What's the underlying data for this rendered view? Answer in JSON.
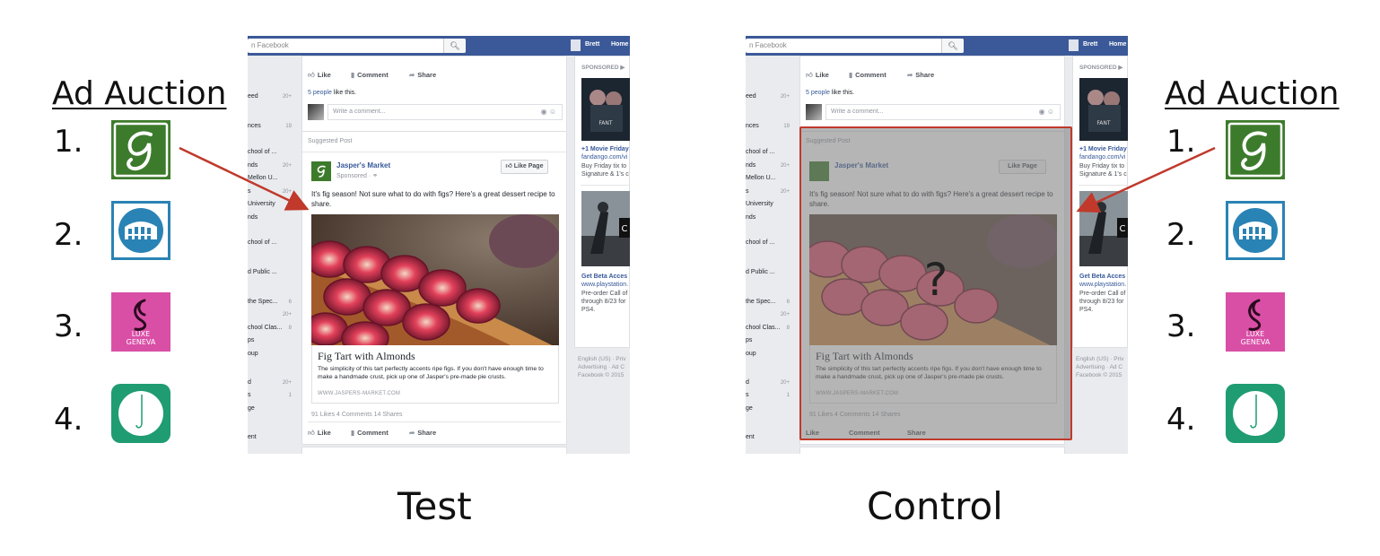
{
  "auction_left": {
    "title": "Ad Auction",
    "ranks": [
      "1.",
      "2.",
      "3.",
      "4."
    ],
    "logos": [
      "jaspers-market-logo-icon",
      "colosseum-logo-icon",
      "luxe-geneva-logo-icon",
      "hook-logo-icon"
    ],
    "luxe_geneva_text": [
      "LUXE",
      "GENEVA"
    ]
  },
  "auction_right": {
    "title": "Ad Auction",
    "ranks": [
      "1.",
      "2.",
      "3.",
      "4."
    ],
    "luxe_geneva_text": [
      "LUXE",
      "GENEVA"
    ]
  },
  "colors": {
    "facebook_blue": "#3b5998",
    "link_blue": "#365899",
    "arrow_red": "#c0392b",
    "jaspers_green": "#3d7b2c",
    "colosseum_blue": "#2a83b5",
    "luxe_pink": "#d94fa6",
    "hook_teal": "#1f9c72"
  },
  "facebook_test": {
    "search_placeholder": "n Facebook",
    "user_name": "Brett",
    "home": "Home",
    "leftnav": [
      {
        "label": "eed",
        "count": "20+"
      },
      {
        "label": "nces",
        "count": "19"
      },
      {
        "label": "chool of ...",
        "count": ""
      },
      {
        "label": "nds",
        "count": "20+"
      },
      {
        "label": "Mellon U...",
        "count": ""
      },
      {
        "label": "s",
        "count": "20+"
      },
      {
        "label": "University",
        "count": ""
      },
      {
        "label": "nds",
        "count": ""
      },
      {
        "label": "chool of ...",
        "count": ""
      },
      {
        "label": "d Public ...",
        "count": ""
      },
      {
        "label": "the Spec...",
        "count": "6"
      },
      {
        "label": "",
        "count": "20+"
      },
      {
        "label": "chool Clas...",
        "count": "8"
      },
      {
        "label": "ps",
        "count": ""
      },
      {
        "label": "oup",
        "count": ""
      },
      {
        "label": "d",
        "count": "20+"
      },
      {
        "label": "s",
        "count": "1"
      },
      {
        "label": "ge",
        "count": ""
      },
      {
        "label": "ent",
        "count": ""
      }
    ],
    "top_actions": {
      "like": "Like",
      "comment": "Comment",
      "share": "Share"
    },
    "likes_count": "5 people",
    "likes_suffix": " like this.",
    "comment_placeholder": "Write a comment...",
    "suggested_post": "Suggested Post",
    "advertiser": "Jasper's Market",
    "sponsored": "Sponsored · ",
    "like_page": "Like Page",
    "post_text": "It's fig season! Not sure what to do with figs? Here's a great dessert recipe to share.",
    "link_title": "Fig Tart with Almonds",
    "link_desc": "The simplicity of this tart perfectly accents ripe figs. If you don't have enough time to make a handmade crust, pick up one of Jasper's pre-made pie crusts.",
    "link_url": "WWW.JASPERS-MARKET.COM",
    "stats": "91 Likes  4 Comments  14 Shares",
    "bottom_actions": {
      "like": "Like",
      "comment": "Comment",
      "share": "Share"
    },
    "rail": {
      "sponsored": "SPONSORED",
      "ad1_title": "+1 Movie Friday",
      "ad1_url": "fandango.com/vi",
      "ad1_desc": [
        "Buy Friday tix to",
        "Signature & 1's c"
      ],
      "ad2_title": "Get Beta Acces",
      "ad2_url": "www.playstation.",
      "ad2_desc": [
        "Pre-order Call of",
        "through 8/23 for",
        "PS4."
      ],
      "footer": [
        "English (US) · Priv",
        "Advertising · Ad C",
        "Facebook © 2015"
      ]
    }
  },
  "facebook_control": {
    "search_placeholder": "n Facebook",
    "user_name": "Brett",
    "home": "Home",
    "question_mark": "?"
  },
  "labels": {
    "test": "Test",
    "control": "Control"
  }
}
